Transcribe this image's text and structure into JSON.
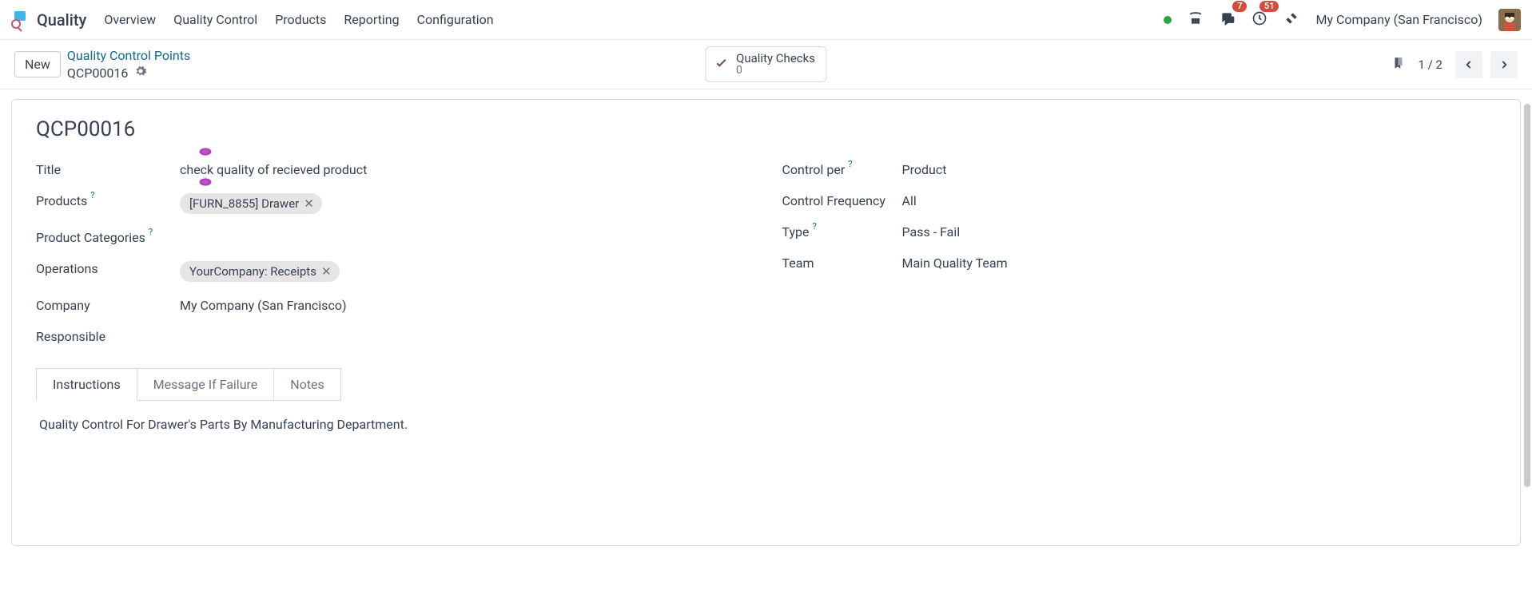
{
  "app": {
    "title": "Quality"
  },
  "nav": {
    "items": [
      "Overview",
      "Quality Control",
      "Products",
      "Reporting",
      "Configuration"
    ]
  },
  "header": {
    "messages_badge": "7",
    "activities_badge": "51",
    "company": "My Company (San Francisco)"
  },
  "subbar": {
    "new_label": "New",
    "breadcrumb_link": "Quality Control Points",
    "breadcrumb_current": "QCP00016",
    "stat_label": "Quality Checks",
    "stat_count": "0",
    "pager": "1 / 2"
  },
  "record": {
    "name": "QCP00016",
    "labels": {
      "title": "Title",
      "products": "Products",
      "product_categories": "Product Categories",
      "operations": "Operations",
      "company": "Company",
      "responsible": "Responsible",
      "control_per": "Control per",
      "control_frequency": "Control Frequency",
      "type": "Type",
      "team": "Team"
    },
    "values": {
      "title": "check quality of recieved product",
      "products_tag": "[FURN_8855] Drawer",
      "operations_tag": "YourCompany: Receipts",
      "company": "My Company (San Francisco)",
      "control_per": "Product",
      "control_frequency": "All",
      "type": "Pass - Fail",
      "team": "Main Quality Team"
    },
    "tabs": [
      "Instructions",
      "Message If Failure",
      "Notes"
    ],
    "instructions_body": "Quality Control For Drawer's Parts By Manufacturing Department."
  }
}
